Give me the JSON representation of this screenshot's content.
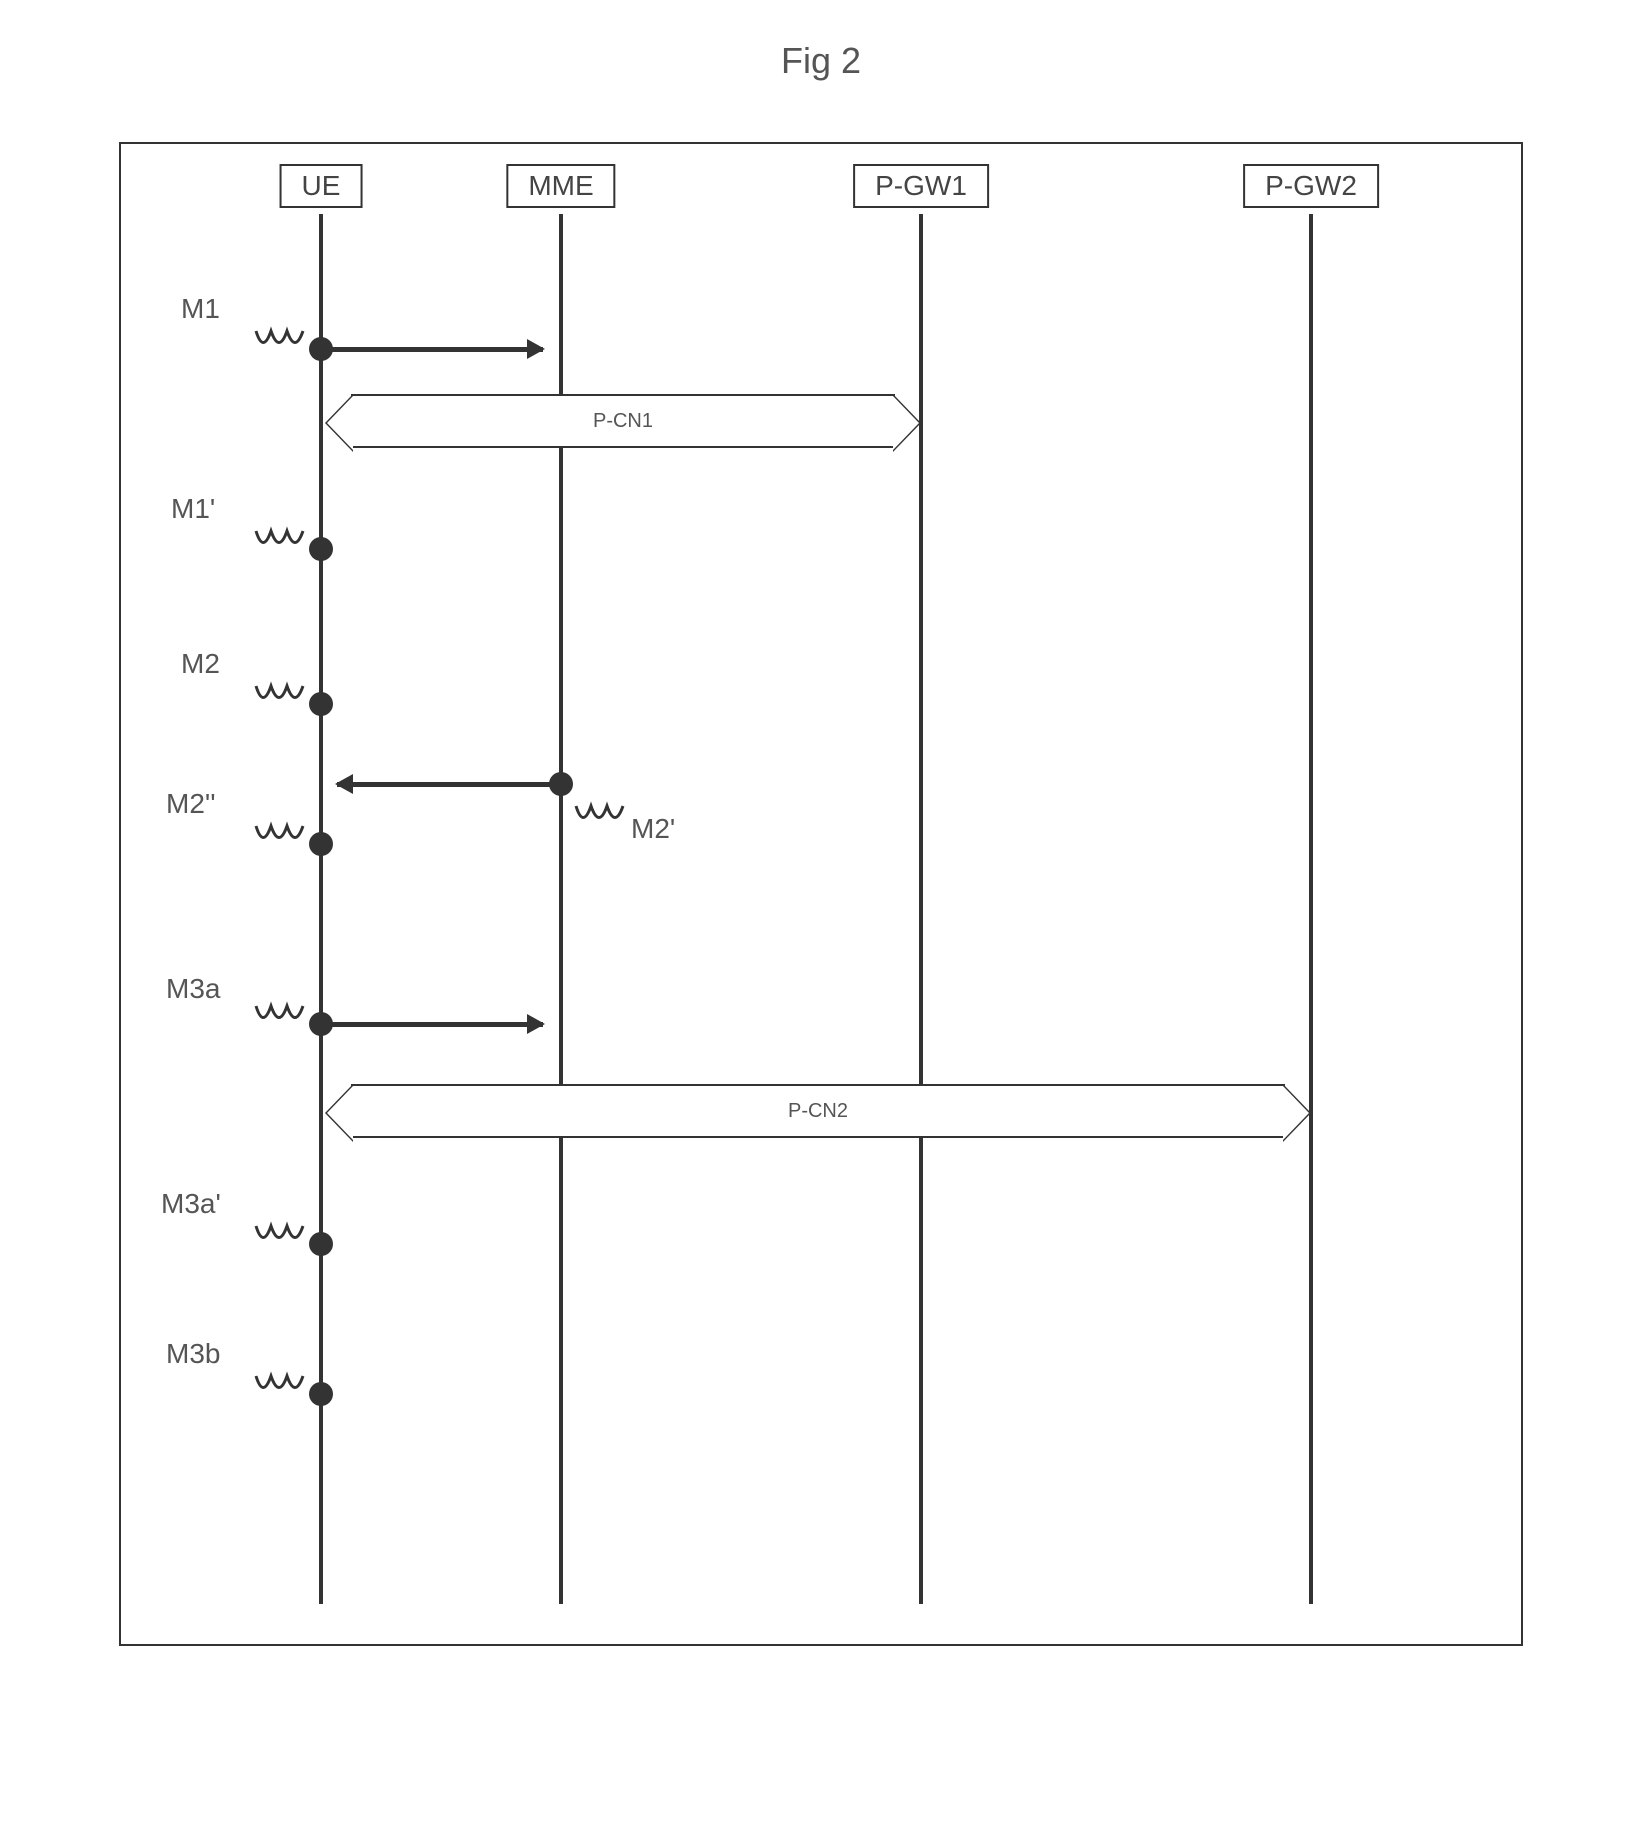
{
  "title": "Fig 2",
  "actors": {
    "ue": "UE",
    "mme": "MME",
    "pgw1": "P-GW1",
    "pgw2": "P-GW2"
  },
  "events": {
    "m1": "M1",
    "m1p": "M1'",
    "m2": "M2",
    "m2p": "M2'",
    "m2pp": "M2''",
    "m3a": "M3a",
    "m3ap": "M3a'",
    "m3b": "M3b"
  },
  "connections": {
    "pcn1": "P-CN1",
    "pcn2": "P-CN2"
  }
}
